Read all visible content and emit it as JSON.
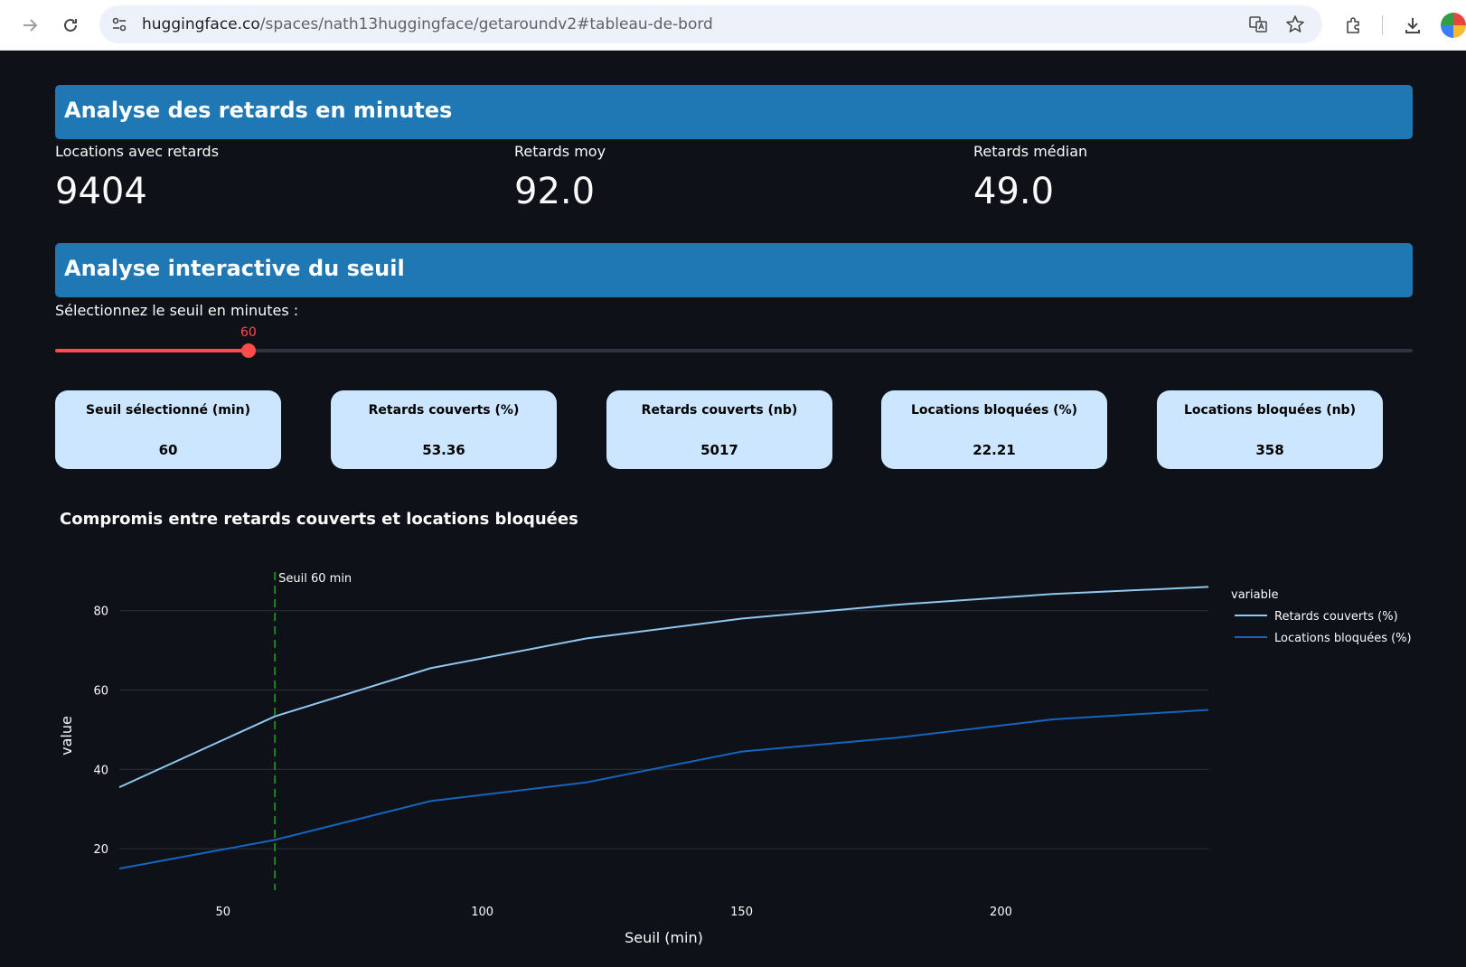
{
  "browser": {
    "url_host": "huggingface.co",
    "url_path": "/spaces/nath13huggingface/getaroundv2#tableau-de-bord"
  },
  "colors": {
    "header_bg": "#1f77b4",
    "slider_accent": "#ff4b4b",
    "kpi_bg": "#cce6ff",
    "series_light": "#8fc8f0",
    "series_dark": "#1565c0",
    "threshold_line": "#1a8a1a"
  },
  "section1": {
    "title": "Analyse des retards en minutes",
    "metrics": [
      {
        "label": "Locations avec retards",
        "value": "9404"
      },
      {
        "label": "Retards moy",
        "value": "92.0"
      },
      {
        "label": "Retards médian",
        "value": "49.0"
      }
    ]
  },
  "section2": {
    "title": "Analyse interactive du seuil",
    "slider": {
      "label": "Sélectionnez le seuil en minutes :",
      "value": "60",
      "position": 0.1424
    },
    "kpis": [
      {
        "title": "Seuil sélectionné (min)",
        "value": "60"
      },
      {
        "title": "Retards couverts (%)",
        "value": "53.36"
      },
      {
        "title": "Retards couverts (nb)",
        "value": "5017"
      },
      {
        "title": "Locations bloquées (%)",
        "value": "22.21"
      },
      {
        "title": "Locations bloquées (nb)",
        "value": "358"
      }
    ]
  },
  "chart_title": "Compromis entre retards couverts et locations bloquées",
  "chart_data": {
    "type": "line",
    "title": "Compromis entre retards couverts et locations bloquées",
    "xlabel": "Seuil (min)",
    "ylabel": "value",
    "xlim": [
      30,
      240
    ],
    "ylim": [
      10,
      87
    ],
    "x_ticks": [
      50,
      100,
      150,
      200
    ],
    "y_ticks": [
      20,
      40,
      60,
      80
    ],
    "grid": "horizontal",
    "legend": {
      "title": "variable",
      "placement": "right"
    },
    "x": [
      30,
      60,
      90,
      120,
      150,
      180,
      210,
      240
    ],
    "series": [
      {
        "name": "Retards couverts (%)",
        "color": "#8fc8f0",
        "values": [
          35.5,
          53.36,
          65.5,
          73.0,
          78.0,
          81.5,
          84.2,
          86.0
        ]
      },
      {
        "name": "Locations bloquées (%)",
        "color": "#1565c0",
        "values": [
          15.0,
          22.21,
          32.0,
          36.7,
          44.5,
          48.0,
          52.6,
          55.0
        ]
      }
    ],
    "annotation": {
      "x": 60,
      "text": "Seuil 60 min"
    }
  }
}
